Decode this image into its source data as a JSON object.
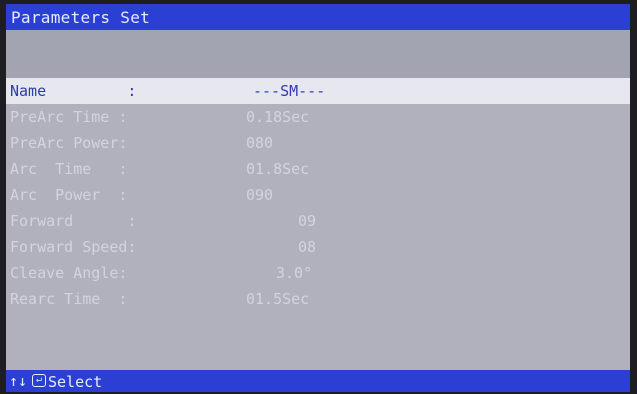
{
  "title": "Parameters Set",
  "rows": [
    {
      "label": "Name         :",
      "value": "---SM---",
      "selected": true
    },
    {
      "label": "PreArc Time :",
      "value": "0.18Sec"
    },
    {
      "label": "PreArc Power:",
      "value": "080"
    },
    {
      "label": "Arc  Time   :",
      "value": "01.8Sec"
    },
    {
      "label": "Arc  Power  :",
      "value": "090"
    },
    {
      "label": "Forward      :",
      "value": "09"
    },
    {
      "label": "Forward Speed:",
      "value": "08"
    },
    {
      "label": "Cleave Angle:",
      "value": "3.0°"
    },
    {
      "label": "Rearc Time  :",
      "value": "01.5Sec"
    }
  ],
  "footer": {
    "arrows": "↑↓",
    "enter_icon": "enter-key-icon",
    "hint": "Select"
  },
  "colors": {
    "title_bar": "#2b3fd4",
    "screen_bg": "#b0b1bd",
    "selected_bg": "#e6e7ef",
    "selected_text": "#2f3bb0",
    "text": "#d3d4dc"
  }
}
